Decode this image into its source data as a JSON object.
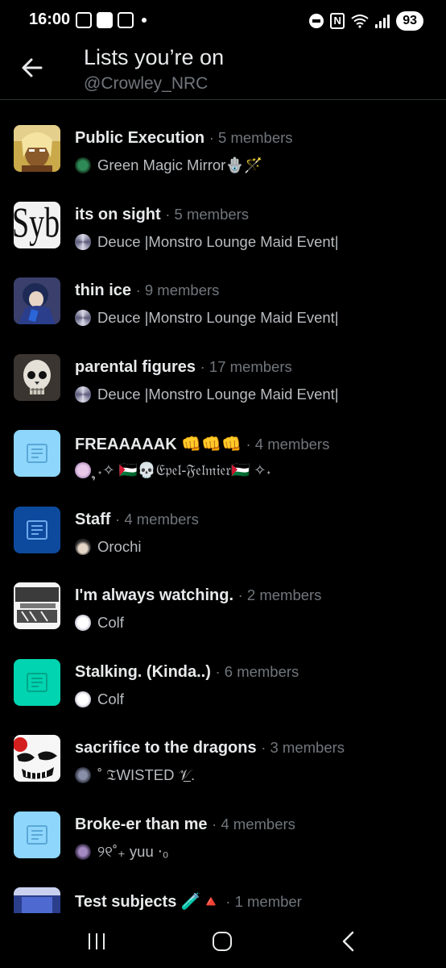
{
  "status_bar": {
    "time": "16:00",
    "battery": "93",
    "nfc": "N"
  },
  "header": {
    "title": "Lists you’re on",
    "handle": "@Crowley_NRC",
    "back_icon": "arrow-left-icon"
  },
  "lists": [
    {
      "name": "Public Execution",
      "members": "· 5 members",
      "owner": "Green Magic Mirror🪬🪄",
      "thumb": "photo"
    },
    {
      "name": "its on sight",
      "members": "· 5 members",
      "owner": "Deuce |Monstro Lounge Maid Event|",
      "thumb": "photo"
    },
    {
      "name": "thin ice",
      "members": "· 9 members",
      "owner": "Deuce |Monstro Lounge Maid Event|",
      "thumb": "photo"
    },
    {
      "name": "parental figures",
      "members": "· 17 members",
      "owner": "Deuce |Monstro Lounge Maid Event|",
      "thumb": "photo"
    },
    {
      "name": "FREAAAAAK 👊👊👊",
      "members": "· 4 members",
      "owner": "ຸ˖✧ 🇵🇸💀𝔈𝔭𝔢𝔩-𝔉𝔢𝔩𝔪𝔦𝔢𝔯🇵🇸 ✧˖",
      "thumb": "generic",
      "thumb_color": "#8ed6fb"
    },
    {
      "name": "Staff",
      "members": "· 4 members",
      "owner": "Orochi",
      "thumb": "generic",
      "thumb_color": "#0d4a9e"
    },
    {
      "name": "I'm always watching.",
      "members": "· 2 members",
      "owner": "Colf",
      "thumb": "photo"
    },
    {
      "name": "Stalking. (Kinda..)",
      "members": "· 6 members",
      "owner": "Colf",
      "thumb": "generic",
      "thumb_color": "#00d4b0"
    },
    {
      "name": "sacrifice to the dragons",
      "members": "· 3 members",
      "owner": "˚ 𝔗WISTED 𝒱̲.",
      "thumb": "photo"
    },
    {
      "name": "Broke-er than me",
      "members": "· 4 members",
      "owner": "୨୧˚₊ yuu ‧₀",
      "thumb": "generic",
      "thumb_color": "#8ed6fb"
    },
    {
      "name": "Test subjects 🧪🔺",
      "members": "· 1 member",
      "owner": "",
      "thumb": "photo"
    }
  ],
  "navbar": {
    "recents_icon": "recents-icon",
    "home_icon": "home-icon",
    "back_icon": "nav-back-icon"
  },
  "colors": {
    "background": "#000000",
    "secondary_text": "#71767b",
    "divider": "#2f3336"
  }
}
